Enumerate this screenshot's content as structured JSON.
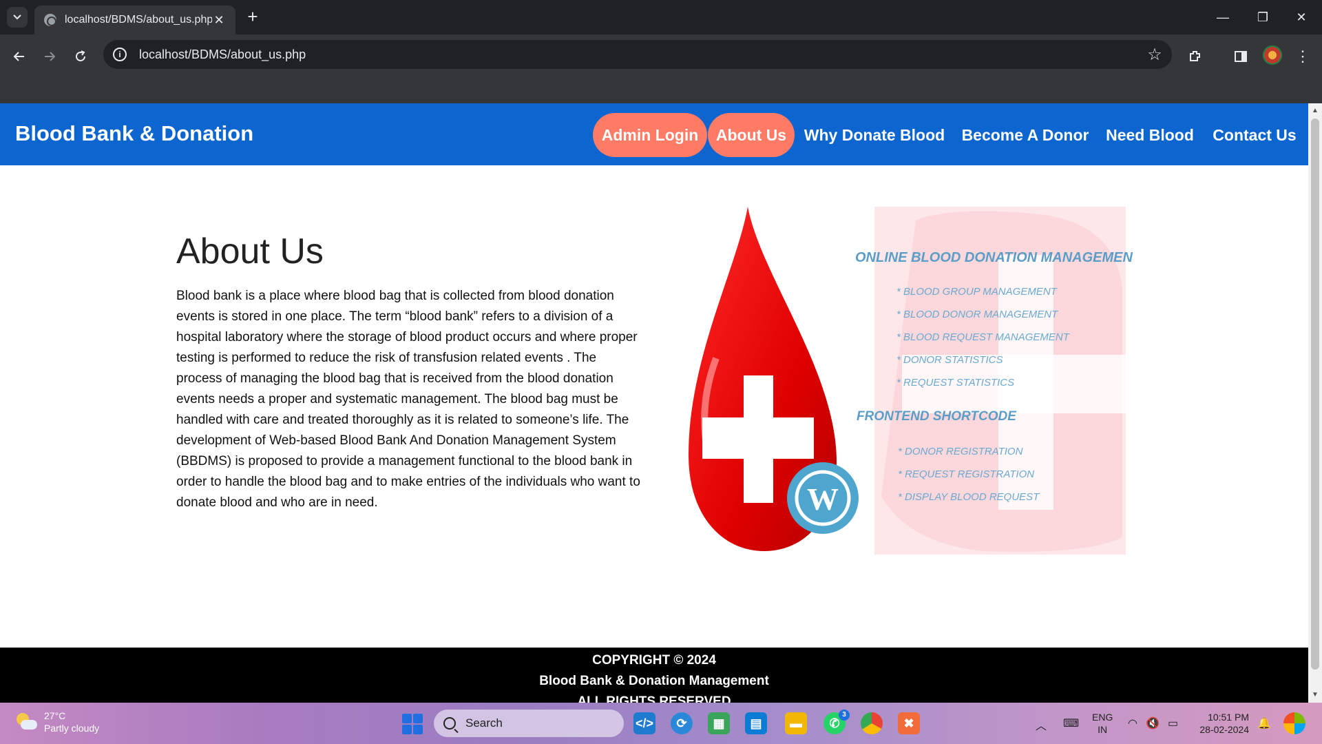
{
  "browser": {
    "tab_title": "localhost/BDMS/about_us.php",
    "url": "localhost/BDMS/about_us.php"
  },
  "site": {
    "brand": "Blood Bank & Donation",
    "nav": [
      {
        "label": "Admin Login",
        "active": true
      },
      {
        "label": "About Us",
        "active": true
      },
      {
        "label": "Why Donate Blood",
        "active": false
      },
      {
        "label": "Become A Donor",
        "active": false
      },
      {
        "label": "Need Blood",
        "active": false
      },
      {
        "label": "Contact Us",
        "active": false
      }
    ],
    "nav_color": "#0d66d0",
    "pill_color": "#ff7b66"
  },
  "about": {
    "title": "About Us",
    "body": "Blood bank is a place where blood bag that is collected from blood donation events is stored in one place. The term “blood bank” refers to a division of a hospital laboratory where the storage of blood product occurs and where proper testing is performed to reduce the risk of transfusion related events . The process of managing the blood bag that is received from the blood donation events needs a proper and systematic management. The blood bag must be handled with care and treated thoroughly as it is related to someone’s life. The development of Web-based Blood Bank And Donation Management System (BBDMS) is proposed to provide a management functional to the blood bank in order to handle the blood bag and to make entries of the individuals who want to donate blood and who are in need."
  },
  "hero_image": {
    "heading": "ONLINE BLOOD DONATION MANAGEMENT SYSTEM",
    "features": [
      "* BLOOD GROUP MANAGEMENT",
      "* BLOOD DONOR MANAGEMENT",
      "* BLOOD REQUEST MANAGEMENT",
      "* DONOR STATISTICS",
      "* REQUEST STATISTICS"
    ],
    "subheading": "FRONTEND  SHORTCODE",
    "shortcodes": [
      "* DONOR REGISTRATION",
      "* REQUEST REGISTRATION",
      "* DISPLAY BLOOD REQUEST"
    ]
  },
  "footer": {
    "line1": "COPYRIGHT © 2024",
    "line2": "Blood Bank & Donation Management",
    "line3": "ALL RIGHTS RESERVED"
  },
  "taskbar": {
    "weather_temp": "27°C",
    "weather_cond": "Partly cloudy",
    "search_placeholder": "Search",
    "whatsapp_badge": "3",
    "lang_line1": "ENG",
    "lang_line2": "IN",
    "time": "10:51 PM",
    "date": "28-02-2024"
  }
}
